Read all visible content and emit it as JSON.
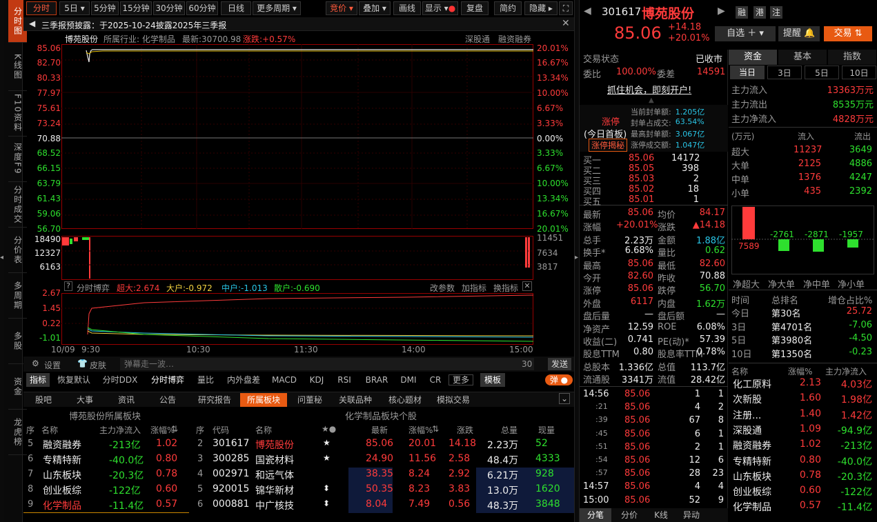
{
  "stock": {
    "code": "301617",
    "name": "博苑股份",
    "price": "85.06",
    "change": "+14.18",
    "change_pct": "+20.01%",
    "badges": [
      "融",
      "港",
      "注"
    ]
  },
  "toolbar": {
    "items": [
      "分时",
      "5日",
      "5分钟",
      "15分钟",
      "30分钟",
      "60分钟",
      "日线",
      "更多周期"
    ],
    "right": [
      "竞价",
      "叠加",
      "画线",
      "显示",
      "复盘",
      "简约",
      "隐藏"
    ]
  },
  "sidebar": [
    "分时图",
    "K线图",
    "F10资料",
    "深度F9",
    "分时成交",
    "分价表",
    "多周期",
    "多股",
    "资金",
    "龙虎榜"
  ],
  "notice": "三季报预披露：于2025-10-24披露2025年三季报",
  "chart_header": {
    "name": "博苑股份",
    "industry": "所属行业: 化学制品",
    "latest": "最新:30700.98",
    "change": "涨跌:+0.57%",
    "links": [
      "深股通",
      "融资融券"
    ]
  },
  "price_axis": {
    "left": [
      "85.06",
      "82.70",
      "80.33",
      "77.97",
      "75.61",
      "73.24",
      "70.88",
      "68.52",
      "66.15",
      "63.79",
      "61.43",
      "59.06",
      "56.70"
    ],
    "right": [
      "20.01%",
      "16.67%",
      "13.34%",
      "10.00%",
      "6.67%",
      "3.33%",
      "0.00%",
      "3.33%",
      "6.67%",
      "10.00%",
      "13.34%",
      "16.67%",
      "20.01%"
    ]
  },
  "vol_axis": {
    "left": [
      "18490",
      "12327",
      "6163"
    ],
    "right": [
      "11451",
      "7634",
      "3817"
    ]
  },
  "game": {
    "title": "分时博弈",
    "items": [
      "超大:2.674",
      "大户:-0.972",
      "中户:-1.013",
      "散户:-0.690"
    ],
    "links": [
      "改参数",
      "加指标",
      "换指标"
    ],
    "axis": [
      "2.67",
      "1.45",
      "0.22",
      "-1.01"
    ]
  },
  "time_axis": [
    "10/09",
    "9:30",
    "10:30",
    "11:30",
    "14:00",
    "15:00"
  ],
  "bottom_bar": {
    "settings": "设置",
    "skin": "皮肤",
    "danmu_placeholder": "弹幕走一波…",
    "count": "30",
    "send": "发送"
  },
  "indicators": [
    "指标",
    "恢复默认",
    "分时DDX",
    "分时博弈",
    "量比",
    "内外盘差",
    "MACD",
    "KDJ",
    "RSI",
    "BRAR",
    "DMI",
    "CR",
    "更多",
    "模板",
    "弹"
  ],
  "tabs": [
    "股吧",
    "大事",
    "资讯",
    "公告",
    "研究报告",
    "所属板块",
    "问董秘",
    "关联品种",
    "核心题材",
    "模拟交易"
  ],
  "sector_left": {
    "title": "博苑股份所属板块",
    "headers": [
      "序",
      "名称",
      "主力净流入",
      "涨幅%"
    ],
    "rows": [
      [
        "5",
        "融资融券",
        "-213亿",
        "1.02"
      ],
      [
        "6",
        "专精特新",
        "-40.0亿",
        "0.80"
      ],
      [
        "7",
        "山东板块",
        "-20.3亿",
        "0.78"
      ],
      [
        "8",
        "创业板综",
        "-122亿",
        "0.60"
      ],
      [
        "9",
        "化学制品",
        "-11.4亿",
        "0.57"
      ]
    ]
  },
  "sector_right": {
    "title": "化学制品板块个股",
    "headers": [
      "序",
      "代码",
      "名称",
      "★●",
      "最新",
      "涨幅%",
      "涨跌",
      "总量",
      "现量"
    ],
    "rows": [
      [
        "2",
        "301617",
        "博苑股份",
        "★",
        "85.06",
        "20.01",
        "14.18",
        "2.23万",
        "52"
      ],
      [
        "3",
        "300285",
        "国瓷材料",
        "★",
        "24.90",
        "11.56",
        "2.58",
        "48.4万",
        "4333"
      ],
      [
        "4",
        "002971",
        "和远气体",
        "",
        "38.35",
        "8.24",
        "2.92",
        "6.21万",
        "928"
      ],
      [
        "5",
        "920015",
        "锦华新材",
        "⬍",
        "50.35",
        "8.23",
        "3.83",
        "13.0万",
        "1620"
      ],
      [
        "6",
        "000881",
        "中广核技",
        "⬍",
        "8.04",
        "7.49",
        "0.56",
        "48.3万",
        "3848"
      ]
    ]
  },
  "right": {
    "watch": "自选",
    "remind": "提醒",
    "trade": "交易",
    "status_label": "交易状态",
    "status": "已收市",
    "webi_label": "委比",
    "webi": "100.00%",
    "weicha_label": "委差",
    "weicha": "14591",
    "promo": "抓住机会，即刻开户!",
    "limit": {
      "title": "涨停",
      "sub": "(今日首板)",
      "btn": "涨停揭秘",
      "items": [
        [
          "当前封单额:",
          "1.205亿"
        ],
        [
          "封单占成交:",
          "63.54%"
        ],
        [
          "最高封单额:",
          "3.067亿"
        ],
        [
          "涨停成交额:",
          "1.047亿"
        ]
      ]
    },
    "bids": [
      [
        "买一",
        "85.06",
        "14172"
      ],
      [
        "买二",
        "85.05",
        "398"
      ],
      [
        "买三",
        "85.03",
        "2"
      ],
      [
        "买四",
        "85.02",
        "18"
      ],
      [
        "买五",
        "85.01",
        "1"
      ]
    ],
    "stats": [
      [
        "最新",
        "85.06",
        "均价",
        "84.17"
      ],
      [
        "涨幅",
        "+20.01%",
        "涨跌",
        "▲14.18"
      ],
      [
        "总手",
        "2.23万",
        "金额",
        "1.88亿"
      ],
      [
        "换手*",
        "6.68%",
        "量比",
        "0.62"
      ],
      [
        "最高",
        "85.06",
        "最低",
        "82.60"
      ],
      [
        "今开",
        "82.60",
        "昨收",
        "70.88"
      ],
      [
        "涨停",
        "85.06",
        "跌停",
        "56.70"
      ],
      [
        "外盘",
        "6117",
        "内盘",
        "1.62万"
      ],
      [
        "盘后量",
        "—",
        "盘后额",
        "—"
      ],
      [
        "净资产",
        "12.59",
        "ROE",
        "6.08%"
      ],
      [
        "收益(二)",
        "0.741",
        "PE(动)*",
        "57.39"
      ],
      [
        "股息TTM",
        "0.80",
        "股息率TTM",
        "0.78%"
      ],
      [
        "总股本",
        "1.336亿",
        "总值",
        "113.7亿"
      ],
      [
        "流通股",
        "3341万",
        "流值",
        "28.42亿"
      ]
    ],
    "ticks": [
      [
        "14:56",
        "85.06",
        "1",
        "1"
      ],
      [
        ":21",
        "85.06",
        "4",
        "2"
      ],
      [
        ":39",
        "85.06",
        "67",
        "8"
      ],
      [
        ":45",
        "85.06",
        "6",
        "1"
      ],
      [
        ":51",
        "85.06",
        "2",
        "1"
      ],
      [
        ":54",
        "85.06",
        "12",
        "6"
      ],
      [
        ":57",
        "85.06",
        "28",
        "23"
      ],
      [
        "14:57",
        "85.06",
        "4",
        "4"
      ],
      [
        "15:00",
        "85.06",
        "52",
        "9"
      ]
    ],
    "tick_tabs": [
      "分笔",
      "分价",
      "K线",
      "异动"
    ]
  },
  "fund": {
    "tabs": [
      "资金",
      "基本",
      "指数"
    ],
    "periods": [
      "当日",
      "3日",
      "5日",
      "10日"
    ],
    "flow": [
      [
        "主力流入",
        "13363万元"
      ],
      [
        "主力流出",
        "8535万元"
      ],
      [
        "主力净流入",
        "4828万元"
      ]
    ],
    "table_headers": [
      "(万元)",
      "流入",
      "流出"
    ],
    "table": [
      [
        "超大",
        "11237",
        "3649"
      ],
      [
        "大单",
        "2125",
        "4886"
      ],
      [
        "中单",
        "1376",
        "4247"
      ],
      [
        "小单",
        "435",
        "2392"
      ]
    ],
    "bars": [
      "7589",
      "-2761",
      "-2871",
      "-1957"
    ],
    "bar_labels": [
      "净超大",
      "净大单",
      "净中单",
      "净小单"
    ],
    "rank_headers": [
      "时间",
      "总排名",
      "增仓占比%"
    ],
    "rank": [
      [
        "今日",
        "第30名",
        "25.72"
      ],
      [
        "3日",
        "第4701名",
        "-7.06"
      ],
      [
        "5日",
        "第3980名",
        "-4.50"
      ],
      [
        "10日",
        "第1350名",
        "-0.23"
      ]
    ],
    "sec_headers": [
      "名称",
      "涨幅%",
      "主力净流入"
    ],
    "sectors": [
      [
        "化工原料",
        "2.13",
        "4.03亿"
      ],
      [
        "次新股",
        "1.60",
        "1.98亿"
      ],
      [
        "注册...",
        "1.40",
        "1.42亿"
      ],
      [
        "深股通",
        "1.09",
        "-94.9亿"
      ],
      [
        "融资融券",
        "1.02",
        "-213亿"
      ],
      [
        "专精特新",
        "0.80",
        "-40.0亿"
      ],
      [
        "山东板块",
        "0.78",
        "-20.3亿"
      ],
      [
        "创业板综",
        "0.60",
        "-122亿"
      ],
      [
        "化学制品",
        "0.57",
        "-11.4亿"
      ]
    ]
  },
  "colors": {
    "up": "#ff3b3b",
    "down": "#2ee02e",
    "accent": "#ff6a1a"
  }
}
